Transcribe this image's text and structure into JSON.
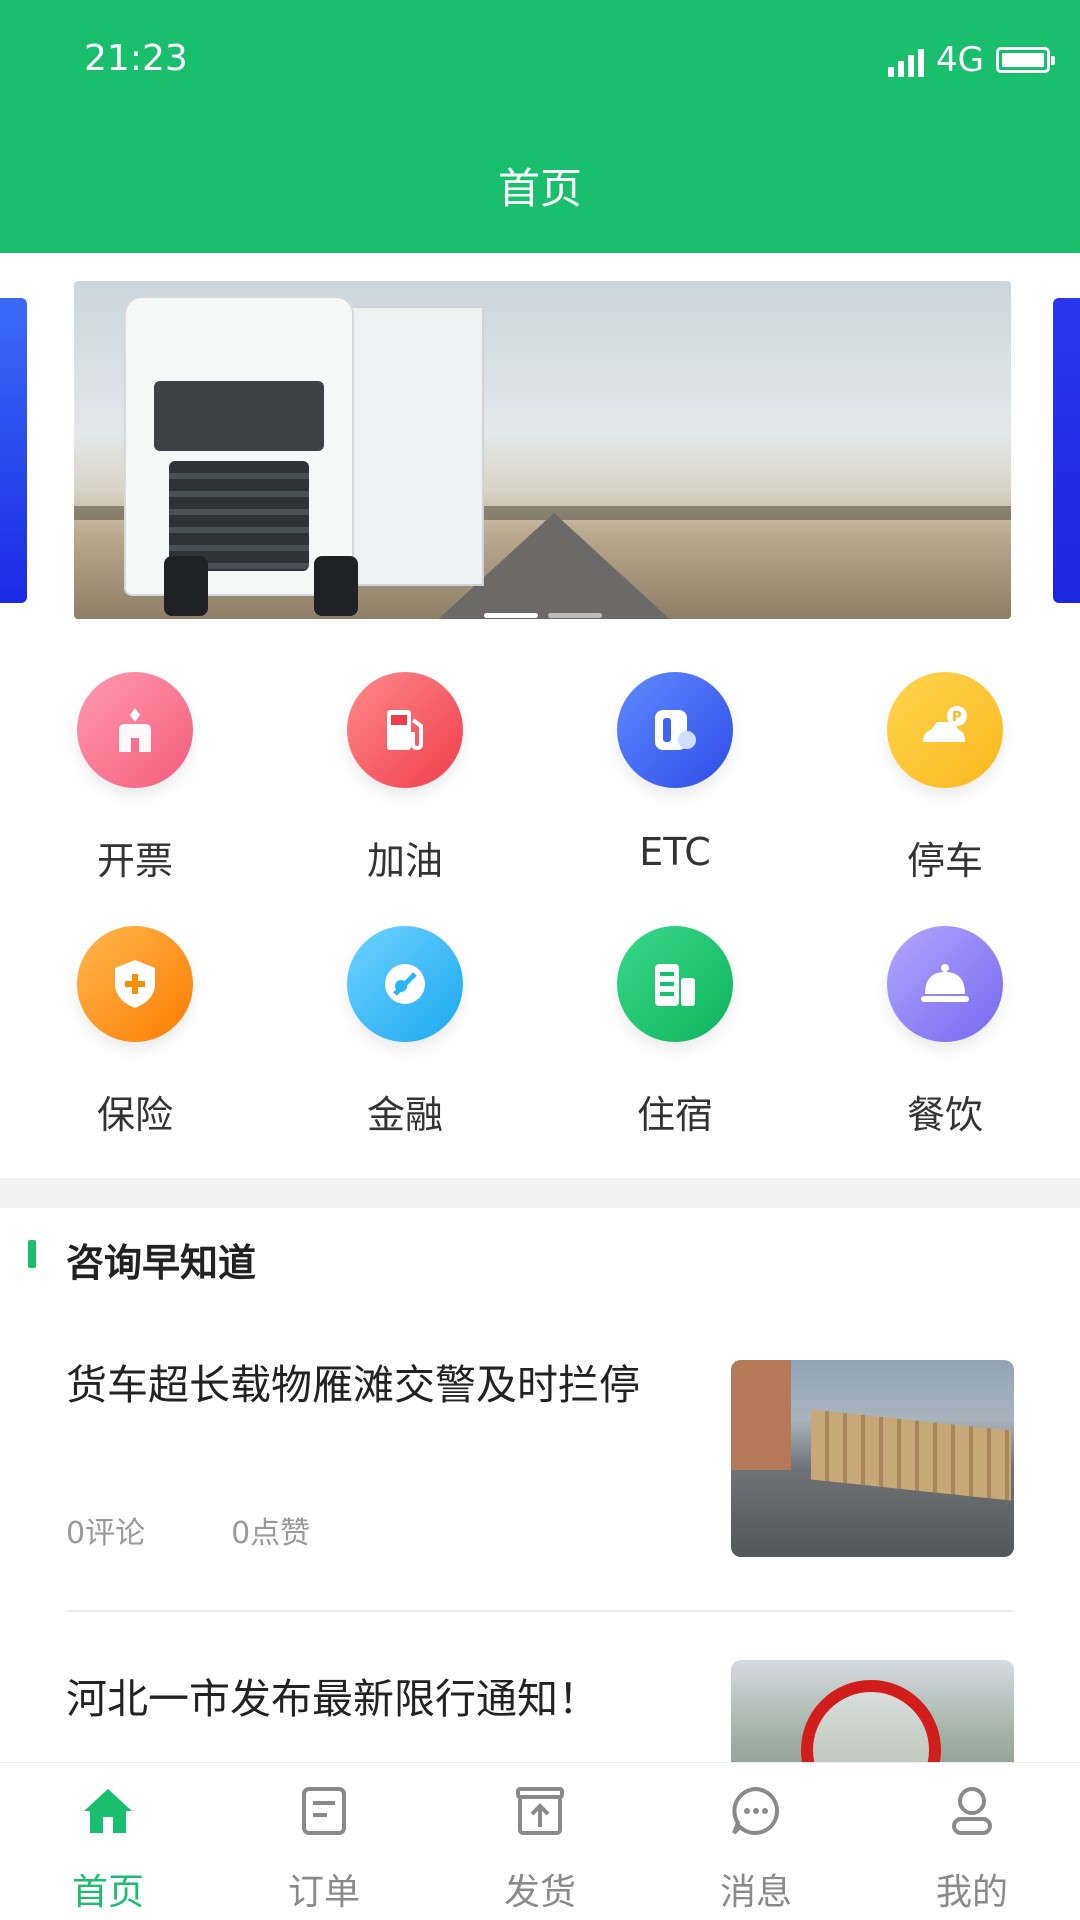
{
  "status_bar": {
    "time": "21:23",
    "network": "4G"
  },
  "header": {
    "title": "首页"
  },
  "banner": {
    "slide_count": 2,
    "active_slide": 1
  },
  "services": [
    {
      "label": "开票",
      "icon": "invoice-icon",
      "color": "#f8718c"
    },
    {
      "label": "加油",
      "icon": "fuel-pump-icon",
      "color": "#f5515f"
    },
    {
      "label": "ETC",
      "icon": "etc-card-icon",
      "color": "#3f63f3"
    },
    {
      "label": "停车",
      "icon": "parking-icon",
      "color": "#fbc02d"
    },
    {
      "label": "保险",
      "icon": "insurance-shield-icon",
      "color": "#fb8c00"
    },
    {
      "label": "金融",
      "icon": "finance-icon",
      "color": "#29b6f6"
    },
    {
      "label": "住宿",
      "icon": "hotel-icon",
      "color": "#17c16b"
    },
    {
      "label": "餐饮",
      "icon": "dining-cloche-icon",
      "color": "#8c7cf3"
    }
  ],
  "news_section": {
    "title": "咨询早知道",
    "items": [
      {
        "title": "货车超长载物雁滩交警及时拦停",
        "comments": "0评论",
        "likes": "0点赞"
      },
      {
        "title": "河北一市发布最新限行通知！"
      }
    ]
  },
  "bottom_nav": [
    {
      "label": "首页",
      "icon": "home-icon",
      "active": true
    },
    {
      "label": "订单",
      "icon": "order-icon",
      "active": false
    },
    {
      "label": "发货",
      "icon": "ship-upload-icon",
      "active": false
    },
    {
      "label": "消息",
      "icon": "message-icon",
      "active": false
    },
    {
      "label": "我的",
      "icon": "profile-icon",
      "active": false
    }
  ],
  "colors": {
    "brand": "#1abf6d",
    "nav_inactive": "#8a8a8a"
  }
}
